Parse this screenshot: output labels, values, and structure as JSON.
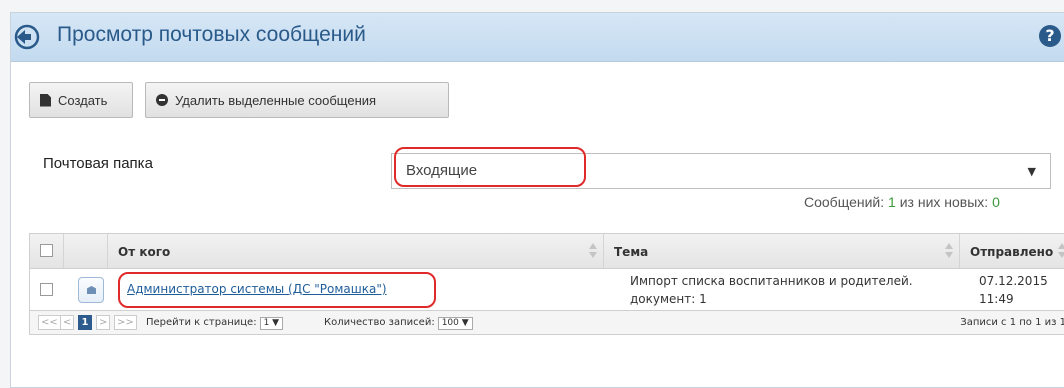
{
  "header": {
    "title": "Просмотр почтовых сообщений",
    "help_icon": "help-icon",
    "back_icon": "back-arrow-icon"
  },
  "toolbar": {
    "create_label": "Создать",
    "delete_label": "Удалить выделенные сообщения"
  },
  "folder": {
    "label": "Почтовая папка",
    "selected": "Входящие"
  },
  "counts": {
    "prefix": "Сообщений:",
    "total": "1",
    "middle": "из них новых:",
    "new": "0"
  },
  "table": {
    "columns": [
      "От кого",
      "Тема",
      "Отправлено"
    ],
    "rows": [
      {
        "from": "Администратор системы (ДС \"Ромашка\")",
        "subject_line1": "Импорт списка воспитанников и родителей.",
        "subject_line2": "документ: 1",
        "date": "07.12.2015",
        "time": "11:49"
      }
    ]
  },
  "pager": {
    "first": "<<",
    "prev": "<",
    "current": "1",
    "next": ">",
    "last": ">>",
    "goto_label": "Перейти к странице:",
    "goto_value": "1 ▼",
    "count_label": "Количество записей:",
    "count_value": "100 ▼",
    "records": "Записи с 1 по 1 из 1"
  },
  "colors": {
    "accent": "#2a5a8a",
    "highlight": "#e02a2a",
    "link": "#1f5d9a",
    "count": "#3b9a3b"
  }
}
